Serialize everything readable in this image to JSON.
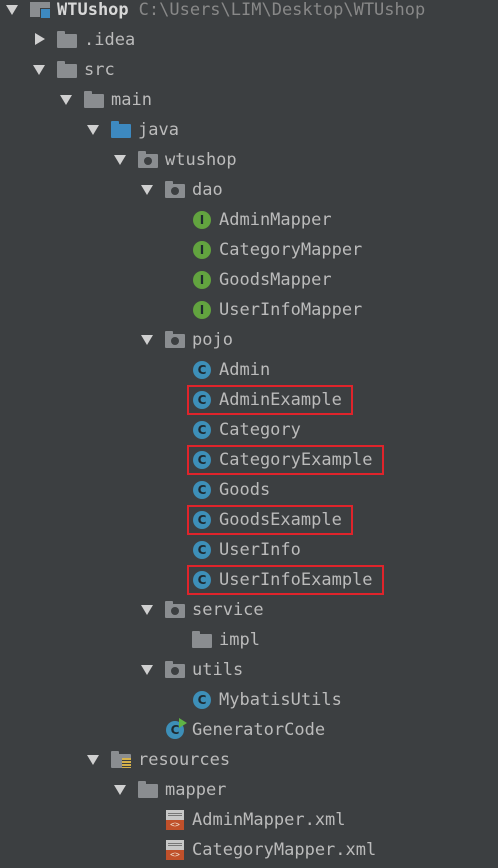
{
  "tree": [
    {
      "name": "WTUshop",
      "detail": "C:\\Users\\LIM\\Desktop\\WTUshop",
      "icon": "module-icon",
      "depth": 0,
      "arrow": "expanded",
      "bold": true
    },
    {
      "name": ".idea",
      "icon": "folder-icon",
      "depth": 1,
      "arrow": "collapsed"
    },
    {
      "name": "src",
      "icon": "folder-icon",
      "depth": 1,
      "arrow": "expanded"
    },
    {
      "name": "main",
      "icon": "folder-icon",
      "depth": 2,
      "arrow": "expanded"
    },
    {
      "name": "java",
      "icon": "source-folder-icon",
      "depth": 3,
      "arrow": "expanded"
    },
    {
      "name": "wtushop",
      "icon": "package-icon",
      "depth": 4,
      "arrow": "expanded"
    },
    {
      "name": "dao",
      "icon": "package-icon",
      "depth": 5,
      "arrow": "expanded"
    },
    {
      "name": "AdminMapper",
      "icon": "interface-icon",
      "depth": 6,
      "arrow": "none"
    },
    {
      "name": "CategoryMapper",
      "icon": "interface-icon",
      "depth": 6,
      "arrow": "none"
    },
    {
      "name": "GoodsMapper",
      "icon": "interface-icon",
      "depth": 6,
      "arrow": "none"
    },
    {
      "name": "UserInfoMapper",
      "icon": "interface-icon",
      "depth": 6,
      "arrow": "none"
    },
    {
      "name": "pojo",
      "icon": "package-icon",
      "depth": 5,
      "arrow": "expanded"
    },
    {
      "name": "Admin",
      "icon": "class-icon",
      "depth": 6,
      "arrow": "none"
    },
    {
      "name": "AdminExample",
      "icon": "class-icon",
      "depth": 6,
      "arrow": "none",
      "highlighted": true
    },
    {
      "name": "Category",
      "icon": "class-icon",
      "depth": 6,
      "arrow": "none"
    },
    {
      "name": "CategoryExample",
      "icon": "class-icon",
      "depth": 6,
      "arrow": "none",
      "highlighted": true
    },
    {
      "name": "Goods",
      "icon": "class-icon",
      "depth": 6,
      "arrow": "none"
    },
    {
      "name": "GoodsExample",
      "icon": "class-icon",
      "depth": 6,
      "arrow": "none",
      "highlighted": true
    },
    {
      "name": "UserInfo",
      "icon": "class-icon",
      "depth": 6,
      "arrow": "none"
    },
    {
      "name": "UserInfoExample",
      "icon": "class-icon",
      "depth": 6,
      "arrow": "none",
      "highlighted": true
    },
    {
      "name": "service",
      "icon": "package-icon",
      "depth": 5,
      "arrow": "expanded"
    },
    {
      "name": "impl",
      "icon": "folder-icon",
      "depth": 6,
      "arrow": "none"
    },
    {
      "name": "utils",
      "icon": "package-icon",
      "depth": 5,
      "arrow": "expanded"
    },
    {
      "name": "MybatisUtils",
      "icon": "class-icon",
      "depth": 6,
      "arrow": "none"
    },
    {
      "name": "GeneratorCode",
      "icon": "runnable-class-icon",
      "depth": 5,
      "arrow": "none"
    },
    {
      "name": "resources",
      "icon": "resources-folder-icon",
      "depth": 3,
      "arrow": "expanded"
    },
    {
      "name": "mapper",
      "icon": "folder-icon",
      "depth": 4,
      "arrow": "expanded"
    },
    {
      "name": "AdminMapper.xml",
      "icon": "xml-file-icon",
      "depth": 5,
      "arrow": "none"
    },
    {
      "name": "CategoryMapper.xml",
      "icon": "xml-file-icon",
      "depth": 5,
      "arrow": "none"
    }
  ],
  "colors": {
    "background": "#3c3f41",
    "text": "#bbbbbb",
    "highlight_border": "#e0242b",
    "class_badge": "#3d8fb8",
    "interface_badge": "#62a33f",
    "source_folder": "#3d89c0"
  }
}
